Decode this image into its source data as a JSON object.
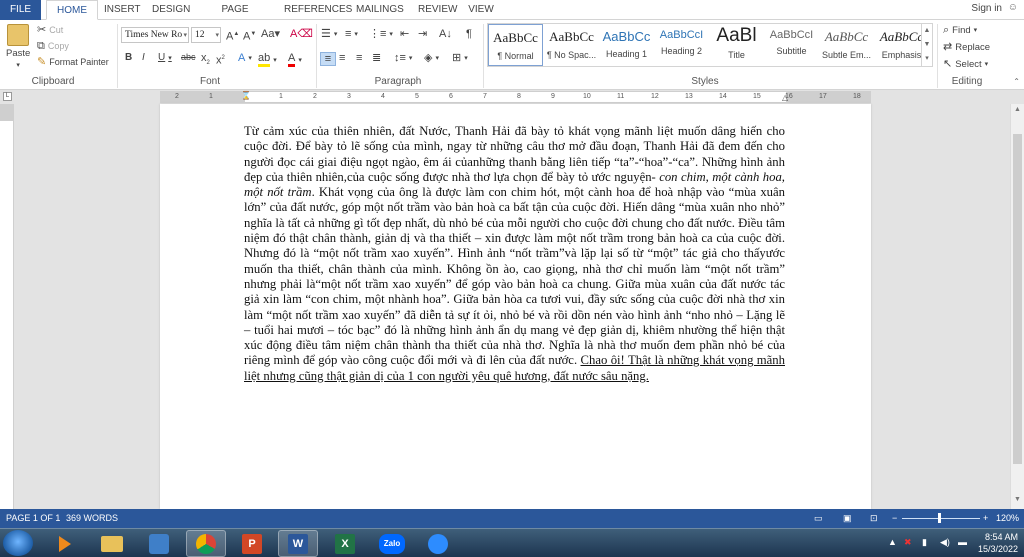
{
  "tabs": {
    "file": "FILE",
    "home": "HOME",
    "insert": "INSERT",
    "design": "DESIGN",
    "page_layout": "PAGE LAYOUT",
    "references": "REFERENCES",
    "mailings": "MAILINGS",
    "review": "REVIEW",
    "view": "VIEW"
  },
  "signin": "Sign in",
  "clipboard": {
    "paste": "Paste",
    "cut": "Cut",
    "copy": "Copy",
    "format_painter": "Format Painter",
    "label": "Clipboard"
  },
  "font": {
    "name": "Times New Ro",
    "size": "12",
    "label": "Font",
    "bold": "B",
    "italic": "I",
    "underline": "U",
    "strike": "abc"
  },
  "paragraph": {
    "label": "Paragraph"
  },
  "styles": {
    "label": "Styles",
    "items": [
      {
        "preview": "AaBbCc",
        "name": "¶ Normal"
      },
      {
        "preview": "AaBbCc",
        "name": "¶ No Spac..."
      },
      {
        "preview": "AaBbCc",
        "name": "Heading 1"
      },
      {
        "preview": "AaBbCcI",
        "name": "Heading 2"
      },
      {
        "preview": "AaBl",
        "name": "Title"
      },
      {
        "preview": "AaBbCcI",
        "name": "Subtitle"
      },
      {
        "preview": "AaBbCc",
        "name": "Subtle Em..."
      },
      {
        "preview": "AaBbCc",
        "name": "Emphasis"
      }
    ]
  },
  "editing": {
    "find": "Find",
    "replace": "Replace",
    "select": "Select",
    "label": "Editing"
  },
  "ruler": {
    "numbers": [
      "2",
      "1",
      "1",
      "2",
      "3",
      "4",
      "5",
      "6",
      "7",
      "8",
      "9",
      "10",
      "11",
      "12",
      "13",
      "14",
      "15",
      "16",
      "17",
      "18"
    ]
  },
  "document": {
    "p1": "Từ cảm xúc của thiên nhiên, đất Nước, Thanh Hải đã bày tỏ khát vọng mãnh liệt muốn dâng hiến cho cuộc đời.  Để bày tỏ lẽ sống của mình, ngay từ những câu thơ mở đầu đoạn, Thanh Hải đã đem đến cho người đọc cái giai điệu ngọt ngào, êm ái củanhững thanh bằng liên tiếp “ta”-“hoa”-“ca”. Những hình ảnh đẹp của thiên nhiên,của cuộc sống  được nhà thơ lựa chọn để bày tỏ ước nguyện- ",
    "p1_italic": "con chim, một cành hoa, một nốt trầm",
    "p2": ". Khát vọng của ông là được làm con chim hót, một cành hoa để hoà nhập vào “mùa xuân lớn” của đất nước, góp một nốt trầm vào bản hoà ca bất tận của cuộc đời. Hiến dâng “mùa xuân nho nhỏ” nghĩa là tất cả những gì tốt đẹp nhất, dù nhỏ bé của mỗi người cho cuộc đời chung cho đất nước. Điều tâm niệm đó thật chân thành, giản dị và tha thiết – xin được làm một nốt trầm trong bản hoà ca của cuộc đời. Nhưng đó là “một nốt trầm xao xuyến”. Hình ảnh “nốt trầm”và lặp lại số từ “một” tác giả cho thấyước muốn tha thiết, chân thành của mình. Không ồn ào, cao giọng, nhà thơ chỉ muốn làm “một nốt trầm” nhưng phải là“một nốt trầm xao xuyến” để góp vào bản hoà ca chung. Giữa mùa xuân của đất nước tác giả xin làm “con chim, một nhành hoa”. Giữa bản hòa ca tươi vui, đầy sức sống của cuộc đời nhà thơ xin làm “một nốt trầm xao xuyến” đã diễn tả sự ít ỏi, nhỏ bé và rồi dồn nén vào hình ảnh “nho nhỏ – Lặng lẽ – tuổi hai mươi – tóc bạc” đó là những hình ảnh ẩn dụ mang vẻ đẹp giản dị, khiêm nhường thể hiện thật xúc động điều tâm niệm chân thành tha thiết của nhà thơ. Nghĩa là nhà thơ muốn đem phần nhỏ bé của riêng mình để góp vào công cuộc đổi mới và đi lên của đất nước. ",
    "p_underline": "Chao ôi! Thật là những khát vọng mãnh liệt nhưng cũng thật giản dị của 1 con người yêu quê hương, đất nước sâu nặng. "
  },
  "status": {
    "page": "PAGE 1 OF 1",
    "words": "369 WORDS",
    "zoom": "120%"
  },
  "taskbar": {
    "word": "W",
    "excel": "X",
    "powerpoint": "P",
    "zalo": "Zalo",
    "time": "8:54 AM",
    "date": "15/3/2022"
  },
  "colors": {
    "accent": "#2b579a"
  }
}
